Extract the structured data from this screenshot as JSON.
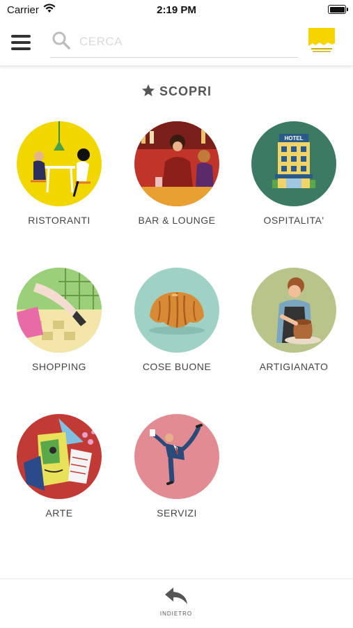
{
  "status_bar": {
    "carrier": "Carrier",
    "time": "2:19 PM"
  },
  "header": {
    "search_placeholder": "CERCA",
    "logo_color": "#f5d400"
  },
  "section": {
    "title": "SCOPRI",
    "icon": "star-icon"
  },
  "categories": [
    {
      "label": "RISTORANTI",
      "icon": "restaurant-illustration",
      "bg": "#f2d600"
    },
    {
      "label": "BAR & LOUNGE",
      "icon": "bar-lounge-illustration",
      "bg": "#c0342a"
    },
    {
      "label": "OSPITALITA'",
      "icon": "hotel-illustration",
      "bg": "#3d7a63"
    },
    {
      "label": "SHOPPING",
      "icon": "shopping-illustration",
      "bg": "#a8cf7a"
    },
    {
      "label": "COSE BUONE",
      "icon": "croissant-illustration",
      "bg": "#9fd2c4"
    },
    {
      "label": "ARTIGIANATO",
      "icon": "craftsman-illustration",
      "bg": "#b8c48a"
    },
    {
      "label": "ARTE",
      "icon": "art-illustration",
      "bg": "#c23a36"
    },
    {
      "label": "SERVIZI",
      "icon": "services-illustration",
      "bg": "#e28b92"
    }
  ],
  "footer": {
    "back_label": "INDIETRO",
    "back_icon": "reply-arrow-icon"
  }
}
